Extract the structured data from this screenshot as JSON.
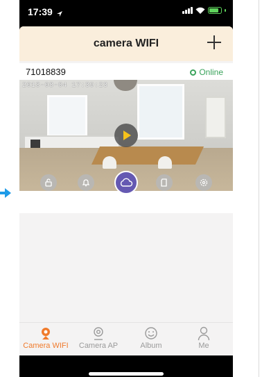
{
  "status_bar": {
    "time": "17:39",
    "icons": [
      "location-arrow-icon",
      "signal-icon",
      "wifi-icon",
      "battery-charging-icon"
    ]
  },
  "header": {
    "title": "camera WIFI",
    "add_icon": "plus-icon"
  },
  "device": {
    "name": "71018839",
    "status": "Online",
    "status_icon": "webcam-icon",
    "status_color": "#3aa35b",
    "preview_timestamp": "2018-08-04 17:39:23",
    "play_icon": "play-icon",
    "actions": [
      {
        "name": "unlock-icon"
      },
      {
        "name": "bell-icon"
      },
      {
        "name": "cloud-icon",
        "active": true
      },
      {
        "name": "sd-card-icon"
      },
      {
        "name": "gear-icon"
      }
    ]
  },
  "tabs": [
    {
      "label": "Camera WIFI",
      "icon": "camera-wifi-icon",
      "active": true
    },
    {
      "label": "Camera AP",
      "icon": "webcam-icon",
      "active": false
    },
    {
      "label": "Album",
      "icon": "album-icon",
      "active": false
    },
    {
      "label": "Me",
      "icon": "person-icon",
      "active": false
    }
  ],
  "colors": {
    "header_bg": "#faeedc",
    "accent": "#f07a2b",
    "cloud_button": "#6559b2",
    "annotation_arrow": "#1e9be8"
  }
}
